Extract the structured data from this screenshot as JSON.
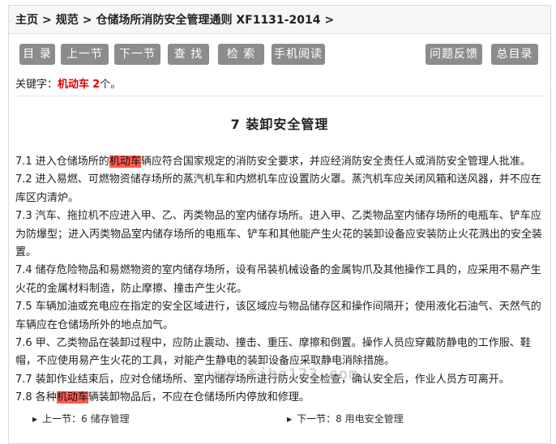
{
  "breadcrumb": {
    "home": "主页",
    "category": "规范",
    "doc": "仓储场所消防安全管理通则 XF1131-2014",
    "sep": ">"
  },
  "toolbar": {
    "toc": "目 录",
    "prev": "上一节",
    "next": "下一节",
    "find": "查 找",
    "search": "检 索",
    "mobile": "手机阅读",
    "feedback": "问题反馈",
    "master": "总目录"
  },
  "keywords": {
    "label": "关键字：",
    "word": "机动车",
    "count": "2",
    "suffix": "个。"
  },
  "section_title": "7 装卸安全管理",
  "paragraphs": {
    "p1_pre": "7.1 进入仓储场所的",
    "p1_hl": "机动车",
    "p1_post": "辆应符合国家规定的消防安全要求，并应经消防安全责任人或消防安全管理人批准。",
    "p2": "7.2 进入易燃、可燃物资储存场所的蒸汽机车和内燃机车应设置防火罩。蒸汽机车应关闭风箱和送风器，并不应在库区内清炉。",
    "p3": "7.3 汽车、拖拉机不应进入甲、乙、丙类物品的室内储存场所。进入甲、乙类物品室内储存场所的电瓶车、铲车应为防爆型；进入丙类物品室内储存场所的电瓶车、铲车和其他能产生火花的装卸设备应安装防止火花溅出的安全装置。",
    "p4": "7.4 储存危险物品和易燃物资的室内储存场所，设有吊装机械设备的金属钩爪及其他操作工具的，应采用不易产生火花的金属材料制造，防止摩擦、撞击产生火花。",
    "p5": "7.5 车辆加油或充电应在指定的安全区域进行，该区域应与物品储存区和操作间隔开；使用液化石油气、天然气的车辆应在仓储场所外的地点加气。",
    "p6": "7.6 甲、乙类物品在装卸过程中，应防止震动、撞击、重压、摩擦和倒置。操作人员应穿戴防静电的工作服、鞋帽，不应使用易产生火花的工具，对能产生静电的装卸设备应采取静电消除措施。",
    "p7": "7.7 装卸作业结束后，应对仓储场所、室内储存场所进行防火安全检查，确认安全后，作业人员方可离开。",
    "p8_pre": "7.8 各种",
    "p8_hl": "机动车",
    "p8_post": "辆装卸物品后，不应在仓储场所内停放和修理。"
  },
  "watermark": "www.tjbz123.com",
  "bottom_nav": {
    "prev_label": "上一节：",
    "prev_link": "6 储存管理",
    "next_label": "下一节：",
    "next_link": "8 用电安全管理"
  },
  "colors": {
    "button_bg": "#8c8c8c",
    "keyword": "#e00000",
    "highlight": "#ff5a50"
  }
}
